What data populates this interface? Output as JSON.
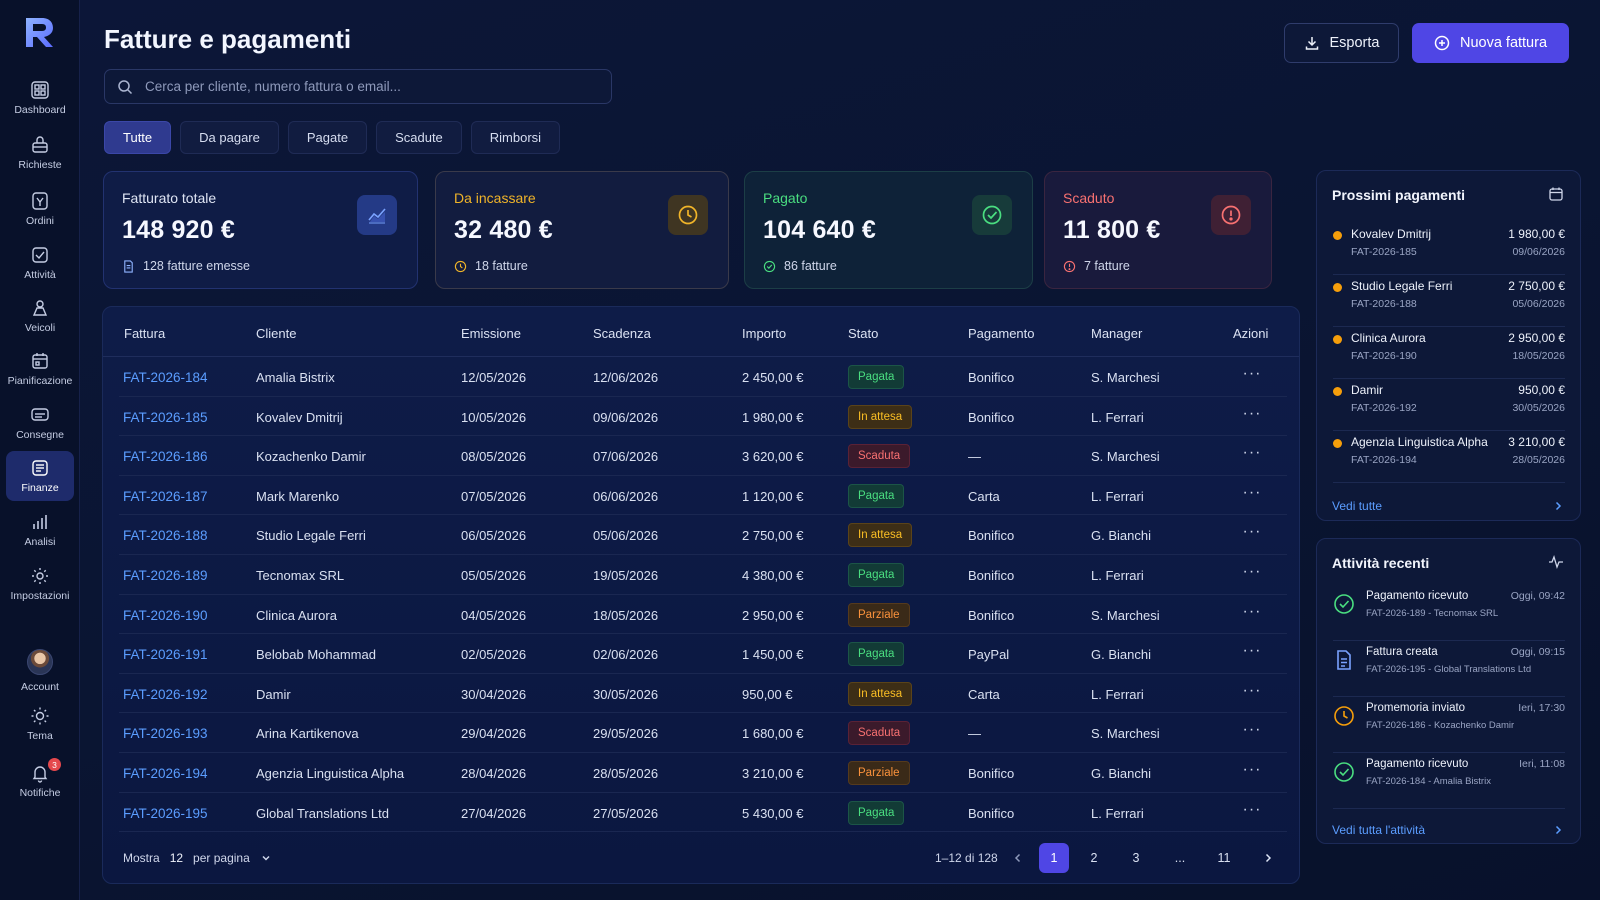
{
  "app": {
    "logo_letter": "R"
  },
  "nav": [
    {
      "label": "Dashboard",
      "icon": "dashboard-icon",
      "active": false
    },
    {
      "label": "Richieste",
      "icon": "inbox-icon",
      "active": false
    },
    {
      "label": "Ordini",
      "icon": "orders-icon",
      "active": false
    },
    {
      "label": "Attività",
      "icon": "activity-icon",
      "active": false
    },
    {
      "label": "Veicoli",
      "icon": "vehicle-icon",
      "active": false
    },
    {
      "label": "Pianificazione",
      "icon": "calendar-icon",
      "active": false
    },
    {
      "label": "Consegne",
      "icon": "delivery-icon",
      "active": false
    },
    {
      "label": "Finanze",
      "icon": "finance-icon",
      "active": true
    },
    {
      "label": "Analisi",
      "icon": "chart-icon",
      "active": false
    },
    {
      "label": "Impostazioni",
      "icon": "gear-icon",
      "active": false
    }
  ],
  "nav_bottom": {
    "account": "Account",
    "theme": "Tema",
    "notifications": "Notifiche",
    "notifications_count": "3"
  },
  "header": {
    "title": "Fatture e pagamenti",
    "search_placeholder": "Cerca per cliente, numero fattura o email...",
    "export_label": "Esporta",
    "new_label": "Nuova fattura"
  },
  "tabs": [
    "Tutte",
    "Da pagare",
    "Pagate",
    "Scadute",
    "Rimborsi"
  ],
  "active_tab": "Tutte",
  "stats": {
    "total": {
      "label": "Fatturato totale",
      "value": "148 920 €",
      "sub": "128 fatture emesse"
    },
    "due": {
      "label": "Da incassare",
      "value": "32 480 €",
      "sub": "18 fatture"
    },
    "paid": {
      "label": "Pagato",
      "value": "104 640 €",
      "sub": "86 fatture"
    },
    "overdue": {
      "label": "Scaduto",
      "value": "11 800 €",
      "sub": "7 fatture"
    }
  },
  "colors": {
    "accent": "#4f46e5",
    "link": "#5b9dff",
    "paid": "#4ade80",
    "pending": "#fbbf24",
    "overdue": "#f87171",
    "partial": "#fb923c"
  },
  "table": {
    "columns": [
      "Fattura",
      "Cliente",
      "Emissione",
      "Scadenza",
      "Importo",
      "Stato",
      "Pagamento",
      "Manager",
      "Azioni"
    ],
    "rows": [
      {
        "id": "FAT-2026-184",
        "client": "Amalia Bistrix",
        "issued": "12/05/2026",
        "due": "12/06/2026",
        "amount": "2 450,00 €",
        "status": "Pagata",
        "status_key": "pagata",
        "method": "Bonifico",
        "manager": "S. Marchesi"
      },
      {
        "id": "FAT-2026-185",
        "client": "Kovalev Dmitrij",
        "issued": "10/05/2026",
        "due": "09/06/2026",
        "amount": "1 980,00 €",
        "status": "In attesa",
        "status_key": "attesa",
        "method": "Bonifico",
        "manager": "L. Ferrari"
      },
      {
        "id": "FAT-2026-186",
        "client": "Kozachenko Damir",
        "issued": "08/05/2026",
        "due": "07/06/2026",
        "amount": "3 620,00 €",
        "status": "Scaduta",
        "status_key": "scaduta",
        "method": "—",
        "manager": "S. Marchesi"
      },
      {
        "id": "FAT-2026-187",
        "client": "Mark Marenko",
        "issued": "07/05/2026",
        "due": "06/06/2026",
        "amount": "1 120,00 €",
        "status": "Pagata",
        "status_key": "pagata",
        "method": "Carta",
        "manager": "L. Ferrari"
      },
      {
        "id": "FAT-2026-188",
        "client": "Studio Legale Ferri",
        "issued": "06/05/2026",
        "due": "05/06/2026",
        "amount": "2 750,00 €",
        "status": "In attesa",
        "status_key": "attesa",
        "method": "Bonifico",
        "manager": "G. Bianchi"
      },
      {
        "id": "FAT-2026-189",
        "client": "Tecnomax SRL",
        "issued": "05/05/2026",
        "due": "19/05/2026",
        "amount": "4 380,00 €",
        "status": "Pagata",
        "status_key": "pagata",
        "method": "Bonifico",
        "manager": "L. Ferrari"
      },
      {
        "id": "FAT-2026-190",
        "client": "Clinica Aurora",
        "issued": "04/05/2026",
        "due": "18/05/2026",
        "amount": "2 950,00 €",
        "status": "Parziale",
        "status_key": "parziale",
        "method": "Bonifico",
        "manager": "S. Marchesi"
      },
      {
        "id": "FAT-2026-191",
        "client": "Belobab Mohammad",
        "issued": "02/05/2026",
        "due": "02/06/2026",
        "amount": "1 450,00 €",
        "status": "Pagata",
        "status_key": "pagata",
        "method": "PayPal",
        "manager": "G. Bianchi"
      },
      {
        "id": "FAT-2026-192",
        "client": "Damir",
        "issued": "30/04/2026",
        "due": "30/05/2026",
        "amount": "950,00 €",
        "status": "In attesa",
        "status_key": "attesa",
        "method": "Carta",
        "manager": "L. Ferrari"
      },
      {
        "id": "FAT-2026-193",
        "client": "Arina Kartikenova",
        "issued": "29/04/2026",
        "due": "29/05/2026",
        "amount": "1 680,00 €",
        "status": "Scaduta",
        "status_key": "scaduta",
        "method": "—",
        "manager": "S. Marchesi"
      },
      {
        "id": "FAT-2026-194",
        "client": "Agenzia Linguistica Alpha",
        "issued": "28/04/2026",
        "due": "28/05/2026",
        "amount": "3 210,00 €",
        "status": "Parziale",
        "status_key": "parziale",
        "method": "Bonifico",
        "manager": "G. Bianchi"
      },
      {
        "id": "FAT-2026-195",
        "client": "Global Translations Ltd",
        "issued": "27/04/2026",
        "due": "27/05/2026",
        "amount": "5 430,00 €",
        "status": "Pagata",
        "status_key": "pagata",
        "method": "Bonifico",
        "manager": "L. Ferrari"
      }
    ],
    "actions_glyph": "···"
  },
  "pagination": {
    "show_label": "Mostra",
    "per_page_value": "12",
    "per_page_label": "per pagina",
    "range": "1–12 di 128",
    "pages": [
      "1",
      "2",
      "3",
      "...",
      "11"
    ],
    "current": "1"
  },
  "upcoming": {
    "title": "Prossimi pagamenti",
    "items": [
      {
        "name": "Kovalev Dmitrij",
        "code": "FAT-2026-185",
        "amount": "1 980,00 €",
        "date": "09/06/2026"
      },
      {
        "name": "Studio Legale Ferri",
        "code": "FAT-2026-188",
        "amount": "2 750,00 €",
        "date": "05/06/2026"
      },
      {
        "name": "Clinica Aurora",
        "code": "FAT-2026-190",
        "amount": "2 950,00 €",
        "date": "18/05/2026"
      },
      {
        "name": "Damir",
        "code": "FAT-2026-192",
        "amount": "950,00 €",
        "date": "30/05/2026"
      },
      {
        "name": "Agenzia Linguistica Alpha",
        "code": "FAT-2026-194",
        "amount": "3 210,00 €",
        "date": "28/05/2026"
      }
    ],
    "link": "Vedi tutte"
  },
  "activity": {
    "title": "Attività recenti",
    "items": [
      {
        "title": "Pagamento ricevuto",
        "desc": "FAT-2026-189 - Tecnomax SRL",
        "time": "Oggi, 09:42",
        "icon": "check-circle-icon"
      },
      {
        "title": "Fattura creata",
        "desc": "FAT-2026-195 - Global Translations Ltd",
        "time": "Oggi, 09:15",
        "icon": "document-icon"
      },
      {
        "title": "Promemoria inviato",
        "desc": "FAT-2026-186 - Kozachenko Damir",
        "time": "Ieri, 17:30",
        "icon": "clock-icon"
      },
      {
        "title": "Pagamento ricevuto",
        "desc": "FAT-2026-184 - Amalia Bistrix",
        "time": "Ieri, 11:08",
        "icon": "check-circle-icon"
      }
    ],
    "link": "Vedi tutta l'attività"
  }
}
